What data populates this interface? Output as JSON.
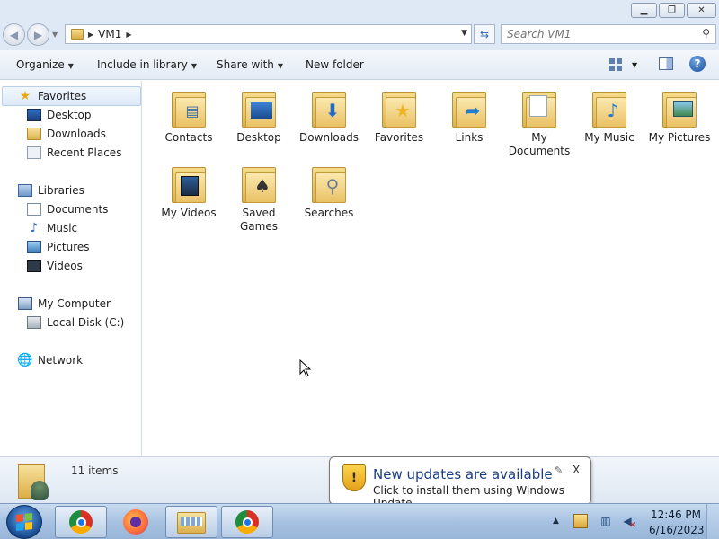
{
  "window": {
    "title_buttons": {
      "minimize": "minimize",
      "maximize": "maximize",
      "close": "close"
    }
  },
  "address": {
    "path": "VM1",
    "search_placeholder": "Search VM1"
  },
  "toolbar": {
    "organize": "Organize",
    "include_in_library": "Include in library",
    "share_with": "Share with",
    "new_folder": "New folder",
    "help": "?"
  },
  "nav": {
    "favorites": {
      "label": "Favorites",
      "items": [
        "Desktop",
        "Downloads",
        "Recent Places"
      ]
    },
    "libraries": {
      "label": "Libraries",
      "items": [
        "Documents",
        "Music",
        "Pictures",
        "Videos"
      ]
    },
    "computer": {
      "label": "My Computer",
      "items": [
        "Local Disk (C:)"
      ]
    },
    "network": {
      "label": "Network"
    }
  },
  "content": {
    "items": [
      {
        "label": "Contacts",
        "icon": "contacts-icon"
      },
      {
        "label": "Desktop",
        "icon": "desktop-icon"
      },
      {
        "label": "Downloads",
        "icon": "downloads-icon"
      },
      {
        "label": "Favorites",
        "icon": "favorites-icon"
      },
      {
        "label": "Links",
        "icon": "links-icon"
      },
      {
        "label": "My Documents",
        "icon": "documents-icon"
      },
      {
        "label": "My Music",
        "icon": "music-icon"
      },
      {
        "label": "My Pictures",
        "icon": "pictures-icon"
      },
      {
        "label": "My Videos",
        "icon": "videos-icon"
      },
      {
        "label": "Saved Games",
        "icon": "games-icon"
      },
      {
        "label": "Searches",
        "icon": "searches-icon"
      }
    ]
  },
  "details": {
    "count": "11 items"
  },
  "balloon": {
    "title": "New updates are available",
    "body": "Click to install them using Windows Update.",
    "close": "X"
  },
  "taskbar": {
    "apps": [
      "chrome-user",
      "firefox",
      "windows-explorer",
      "chrome"
    ],
    "time": "12:46 PM",
    "date": "6/16/2023"
  },
  "colors": {
    "chrome_bg": "#dfe9f5",
    "balloon_title": "#1a3e84",
    "taskbar": "#a7c2e2"
  }
}
